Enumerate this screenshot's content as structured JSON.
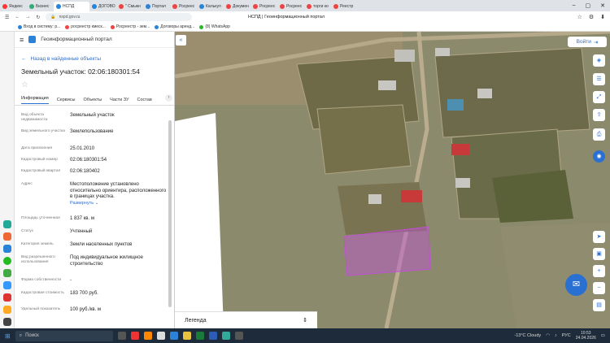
{
  "browser": {
    "tabs": [
      "Яндекс",
      "Бизнес",
      "НСПД",
      "ДОГОВО",
      "\" Смыкн",
      "Портал",
      "Росреес",
      "Калькул",
      "Докумен",
      "Росреес",
      "Росреес",
      "торги ко",
      "Реестр"
    ],
    "active_tab": "НСПД",
    "url": "nspd.gov.ru",
    "page_title": "НСПД | Геоинформационный портал",
    "bookmarks": [
      "Вход в систему: р...",
      "росреестр кмеск...",
      "Росреестр - зем...",
      "Договоры аренд...",
      "(8) WhatsApp"
    ]
  },
  "panel": {
    "portal_name": "Геоинформационный портал",
    "back_link": "Назад в найденные объекты",
    "object_title": "Земельный участок: 02:06:180301:54",
    "tabs": [
      "Информация",
      "Сервисы",
      "Объекты",
      "Части ЗУ",
      "Состав"
    ],
    "attributes": [
      {
        "key": "Вид объекта недвижимости",
        "value": "Земельный участок"
      },
      {
        "key": "Вид земельного участка",
        "value": "Землепользование"
      },
      {
        "key": "Дата присвоения",
        "value": "25.01.2010"
      },
      {
        "key": "Кадастровый номер",
        "value": "02:06:180301:54"
      },
      {
        "key": "Кадастровый квартал",
        "value": "02:06:180402"
      },
      {
        "key": "Адрес",
        "value": "Местоположение установлено относительно ориентира, расположенного в границах участка.",
        "link": "Развернуть"
      },
      {
        "key": "Площадь уточненная",
        "value": "1 837 кв. м"
      },
      {
        "key": "Статус",
        "value": "Учтенный"
      },
      {
        "key": "Категория земель",
        "value": "Земли населенных пунктов"
      },
      {
        "key": "Вид разрешенного использования",
        "value": "Под индивидуальное жилищное строительство"
      },
      {
        "key": "Форма собственности",
        "value": "-"
      },
      {
        "key": "Кадастровая стоимость",
        "value": "183 700 руб."
      },
      {
        "key": "Удельный показатель",
        "value": "100 руб./кв. м"
      }
    ]
  },
  "map": {
    "login": "Войти",
    "legend": "Легенда"
  },
  "taskbar": {
    "search": "Поиск",
    "weather": "-13°C Cloudy",
    "lang": "РУС",
    "time": "10:53",
    "date": "24.04.2026"
  },
  "colors": {
    "accent": "#2a6fd2",
    "highlight": "#c24fd8"
  }
}
